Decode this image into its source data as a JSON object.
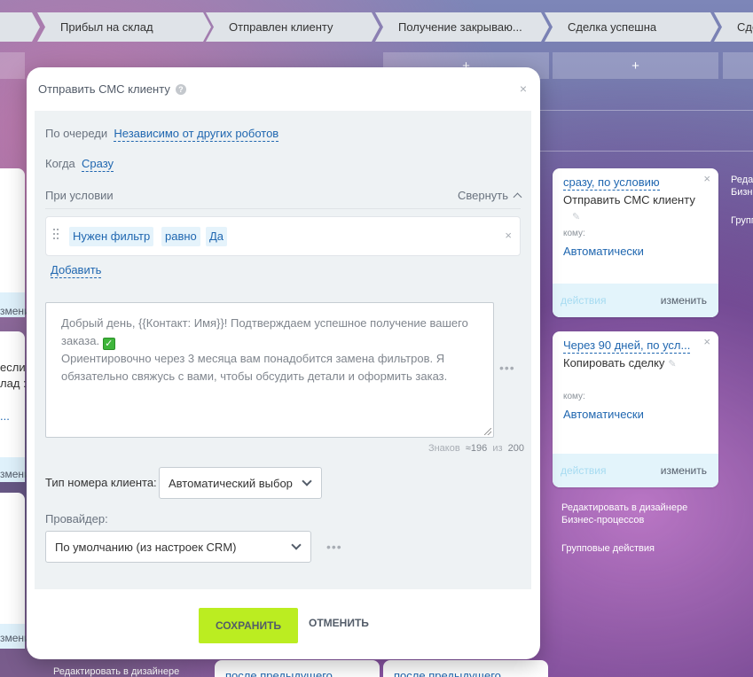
{
  "stages": [
    {
      "label": ""
    },
    {
      "label": "Прибыл на склад"
    },
    {
      "label": "Отправлен клиенту"
    },
    {
      "label": "Получение закрываю..."
    },
    {
      "label": "Сделка успешна"
    },
    {
      "label": "Сде"
    }
  ],
  "stage_add_symbol": "+",
  "modal": {
    "title": "Отправить СМС клиенту",
    "help_symbol": "?",
    "close_symbol": "×",
    "queue_label": "По очереди",
    "queue_value": "Независимо от других роботов",
    "when_label": "Когда",
    "when_value": "Сразу",
    "condition_label": "При условии",
    "collapse_label": "Свернуть",
    "condition": {
      "field": "Нужен фильтр",
      "operator": "равно",
      "value": "Да",
      "remove_symbol": "×"
    },
    "add_label": "Добавить",
    "message_line1": "Добрый день, {{Контакт: Имя}}! Подтверждаем успешное получение вашего заказа.",
    "message_emoji": "✓",
    "message_line2": "Ориентировочно через 3 месяца вам понадобится замена фильтров. Я обязательно свяжусь с вами, чтобы обсудить детали и оформить заказ.",
    "more_symbol": "•••",
    "chars_label": "Знаков",
    "chars_count": "≈196",
    "chars_of": "из",
    "chars_max": "200",
    "number_type_label": "Тип номера клиента:",
    "number_type_value": "Автоматический выбор",
    "provider_label": "Провайдер:",
    "provider_value": "По умолчанию (из настроек CRM)",
    "save_label": "СОХРАНИТЬ",
    "cancel_label": "ОТМЕНИТЬ"
  },
  "robots": [
    {
      "when": "сразу, по условию",
      "title": "Отправить СМС клиенту",
      "to_label": "кому:",
      "to_value": "Автоматически",
      "actions_label": "действия",
      "change_label": "изменить",
      "close_symbol": "×"
    },
    {
      "when": "Через 90 дней, по усл...",
      "title": "Копировать сделку",
      "to_label": "кому:",
      "to_value": "Автоматически",
      "actions_label": "действия",
      "change_label": "изменить",
      "close_symbol": "×"
    }
  ],
  "column_links": {
    "edit_designer": "Редактировать в дизайнере Бизнес-процессов",
    "group_actions": "Групповые действия",
    "edit_designer_partial": "Редакт\nБизнес",
    "group_partial": "Групп",
    "edit_designer_bottom": "Редактировать в дизайнере"
  },
  "left_fragments": {
    "change1": "зменить",
    "text1": "если\nлад :",
    "dots": "...",
    "change2": "зменить",
    "change3": "зменить"
  },
  "bottom_cards": [
    "после предыдущего",
    "после предыдущего"
  ]
}
